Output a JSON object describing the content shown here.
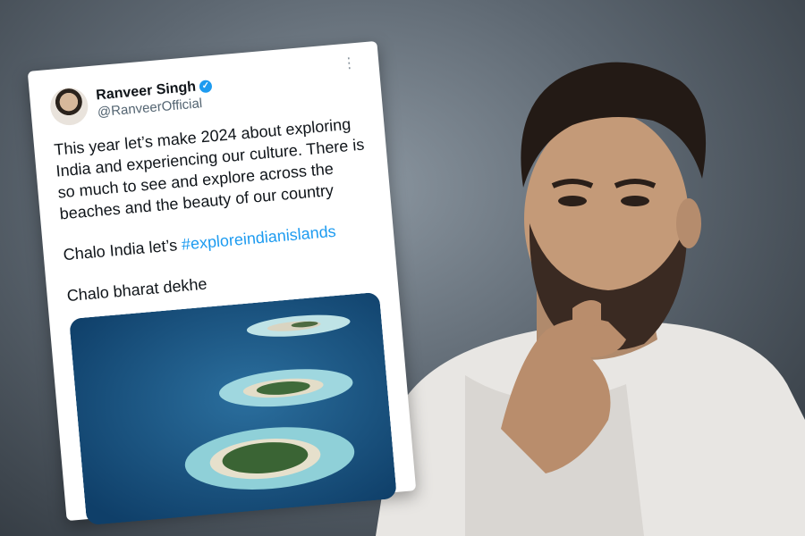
{
  "tweet": {
    "author_name": "Ranveer Singh",
    "handle": "@RanveerOfficial",
    "text_line_1": "This year let’s make 2024 about exploring India and experiencing our culture. There is so much to see and explore across the beaches and the beauty of our country",
    "text_line_2_prefix": "Chalo India let’s ",
    "hashtag": "#exploreindianislands",
    "text_line_3": "Chalo bharat dekhe",
    "more_icon": "more-dots-icon",
    "verified_icon": "verified-badge-icon"
  },
  "colors": {
    "link": "#1d9bf0",
    "verified": "#1d9bf0",
    "text": "#0f1419",
    "handle": "#536471"
  }
}
